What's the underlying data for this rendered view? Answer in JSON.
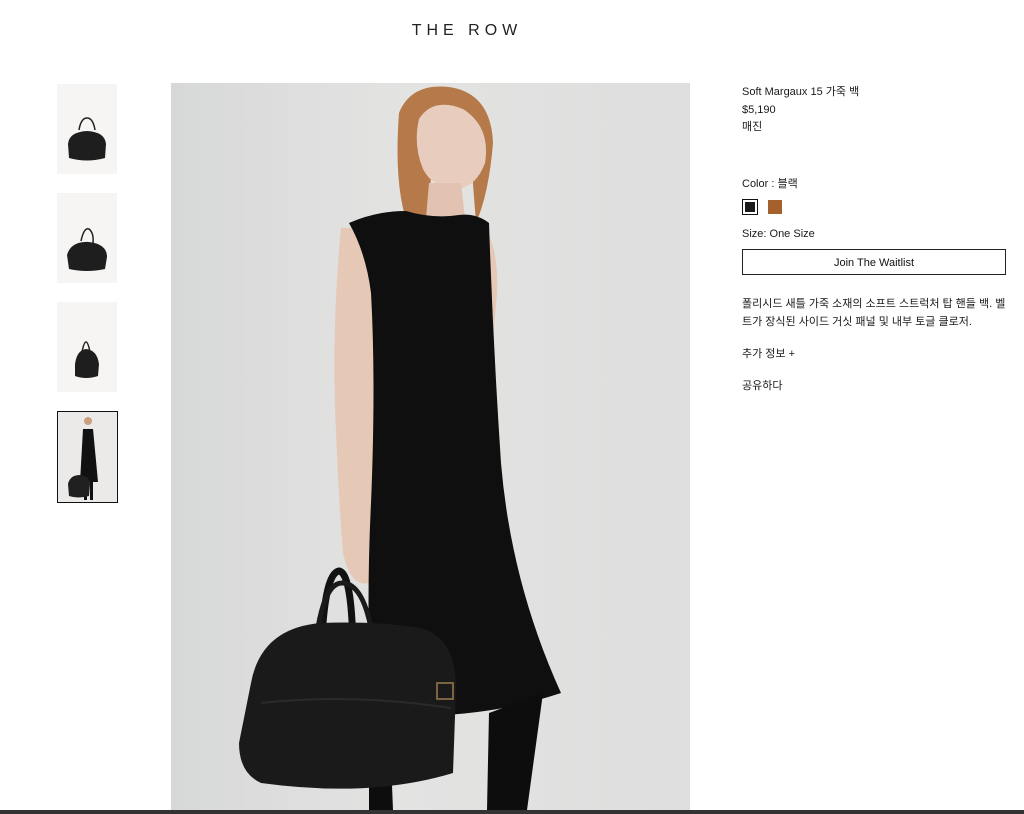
{
  "header": {
    "brand": "THE ROW"
  },
  "gallery": {
    "thumbnails": [
      "bag-front",
      "bag-side",
      "bag-hanging",
      "model-with-bag"
    ],
    "active_index": 3
  },
  "product": {
    "title": "Soft Margaux 15 가죽 백",
    "price": "$5,190",
    "stock_status": "매진",
    "color_label": "Color : 블랙",
    "colors": [
      {
        "name": "블랙",
        "hex": "#1b1b1b"
      },
      {
        "name": "brown",
        "hex": "#a4602d"
      }
    ],
    "size_label": "Size: One Size",
    "waitlist_label": "Join The Waitlist",
    "description": "폴리시드 새틀 가죽 소재의 소프트 스트럭처 탑 핸들 백. 벨트가 장식된 사이드 거싯 패널 및 내부 토글 클로저.",
    "more_info_label": "추가 정보 +",
    "share_label": "공유하다"
  }
}
